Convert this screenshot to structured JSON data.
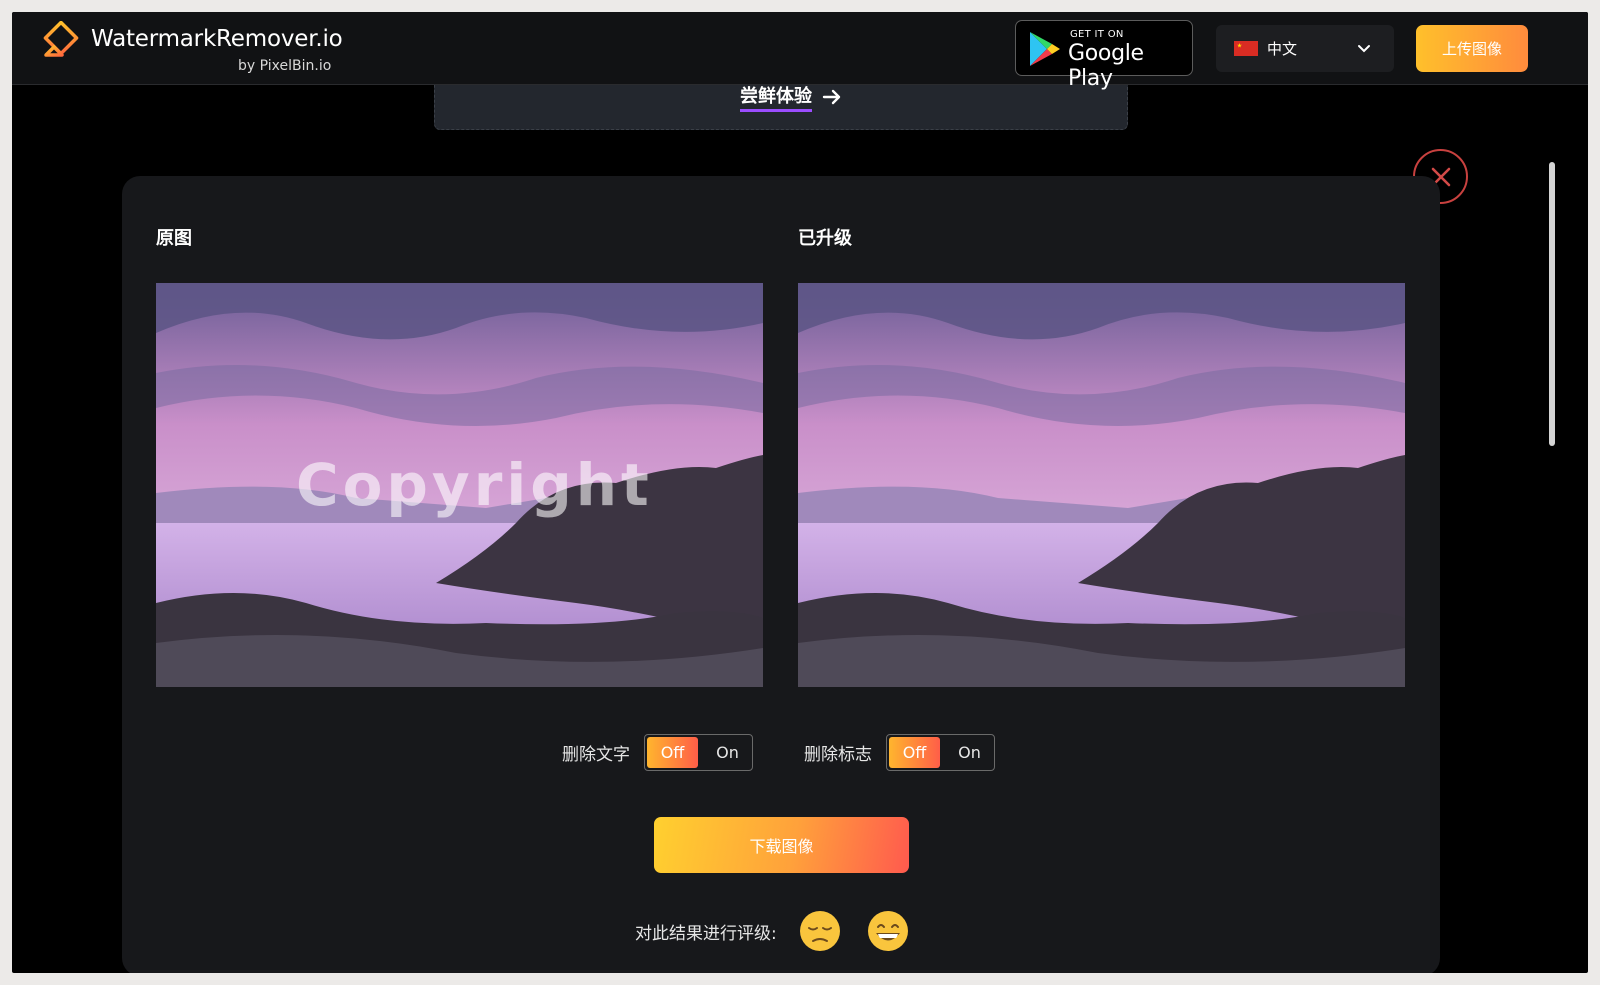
{
  "header": {
    "logo_title": "WatermarkRemover.io",
    "logo_sub": "by PixelBin.io",
    "gplay_small": "GET IT ON",
    "gplay_big": "Google Play",
    "language": "中文",
    "upload_label": "上传图像"
  },
  "banner": {
    "link_label": "尝鲜体验"
  },
  "result": {
    "original_label": "原图",
    "upgraded_label": "已升级",
    "watermark_text": "Copyright",
    "options": [
      {
        "label": "删除文字",
        "off": "Off",
        "on": "On"
      },
      {
        "label": "删除标志",
        "off": "Off",
        "on": "On"
      }
    ],
    "download_label": "下载图像",
    "rate_label": "对此结果进行评级:"
  },
  "colors": {
    "accent_start": "#ffc02b",
    "accent_end": "#ff5e48",
    "close_ring": "#c8413f",
    "link_underline": "#9b4dff"
  },
  "icons": [
    "eraser-logo-icon",
    "google-play-icon",
    "china-flag-icon",
    "chevron-down-icon",
    "arrow-right-icon",
    "close-icon",
    "sad-emoji-icon",
    "happy-emoji-icon"
  ]
}
